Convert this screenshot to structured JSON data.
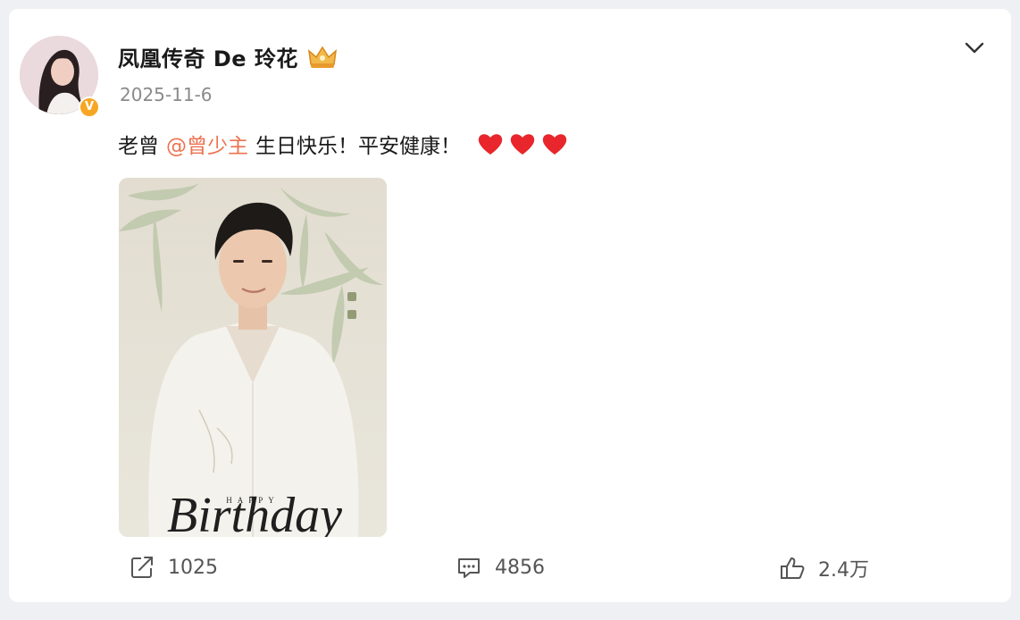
{
  "post": {
    "author": "凤凰传奇 De 玲花",
    "timestamp": "2025-11-6",
    "text_prefix": "老曾",
    "mention": "@曾少主",
    "text_suffix": "生日快乐！平安健康！",
    "image_caption": "Birthday",
    "image_small_text": "HAPPY"
  },
  "actions": {
    "forward_count": "1025",
    "comment_count": "4856",
    "like_count": "2.4万"
  },
  "icons": {
    "verify": "verified-badge-icon",
    "crown": "crown-icon",
    "menu": "chevron-down-icon",
    "heart": "red-heart-icon",
    "forward": "share-forward-icon",
    "comment": "comment-bubble-icon",
    "like": "thumbs-up-icon"
  },
  "colors": {
    "mention": "#eb7350",
    "verify_badge": "#f7a623",
    "heart": "#e8262b"
  }
}
